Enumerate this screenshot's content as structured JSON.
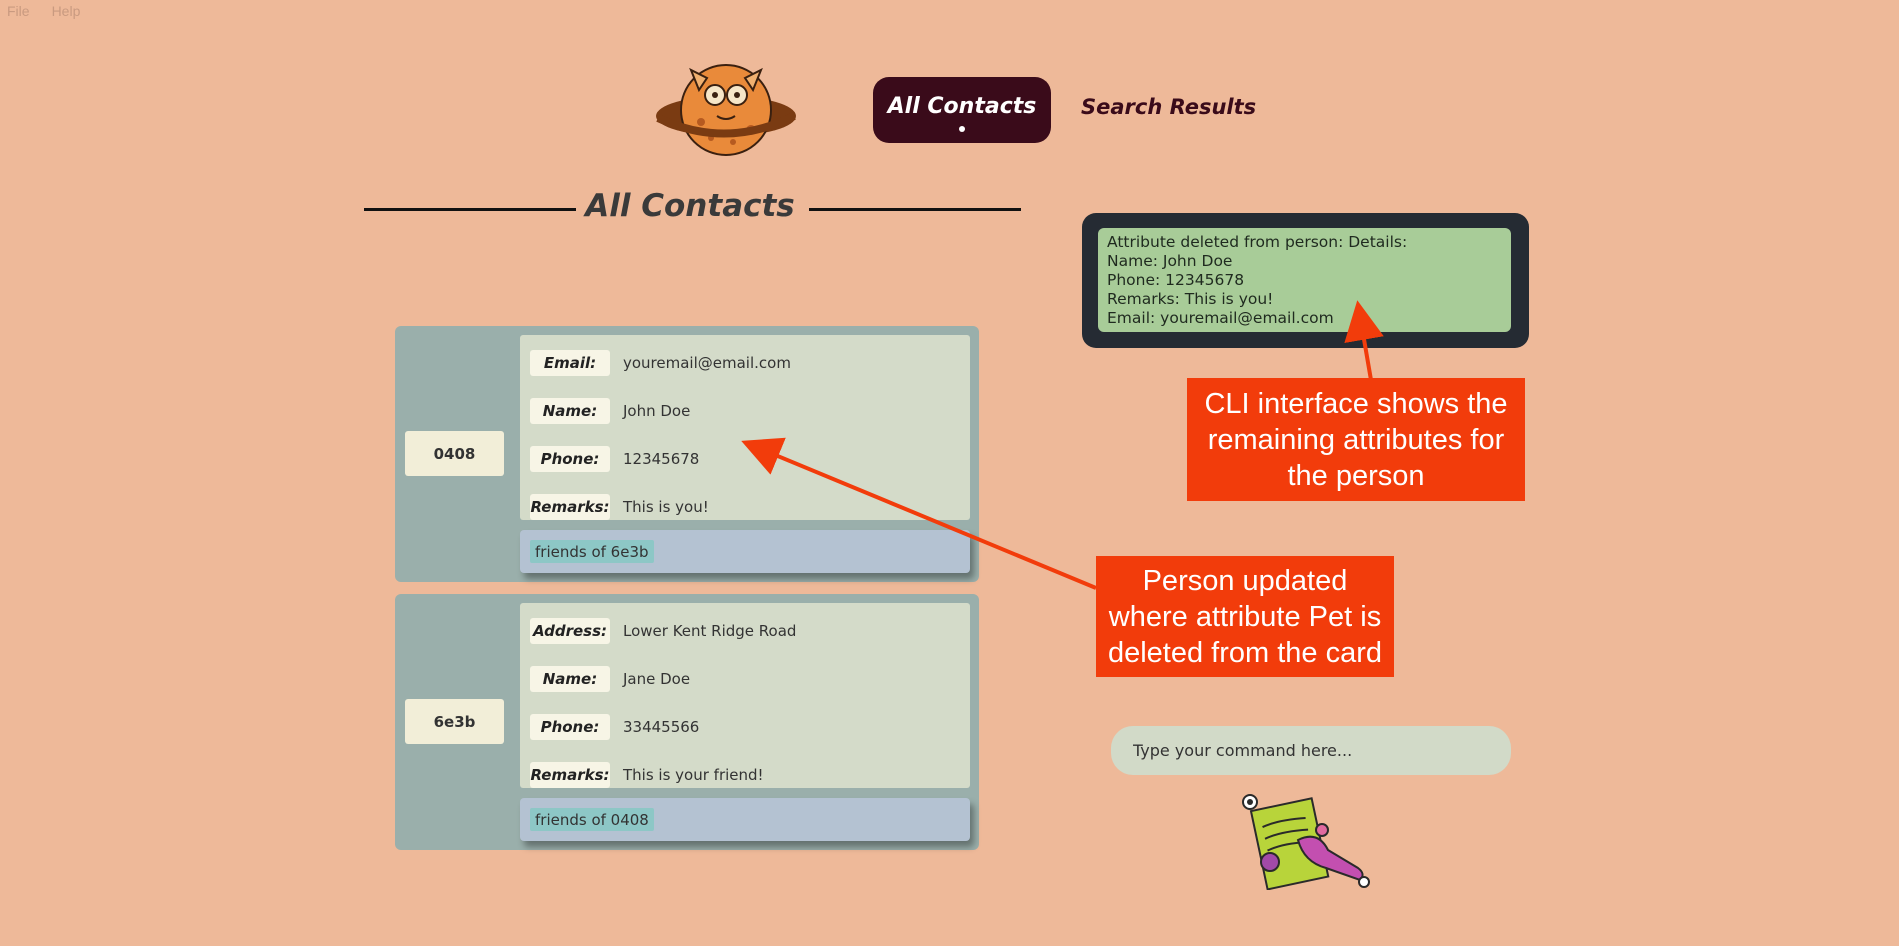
{
  "menu": {
    "file": "File",
    "help": "Help"
  },
  "nav": {
    "tabs": [
      {
        "label": "All Contacts",
        "active": true
      },
      {
        "label": "Search Results",
        "active": false
      }
    ]
  },
  "section_title": "All Contacts",
  "contacts": [
    {
      "id": "0408",
      "fields": [
        {
          "label": "Email:",
          "value": "youremail@email.com"
        },
        {
          "label": "Name:",
          "value": "John Doe"
        },
        {
          "label": "Phone:",
          "value": "12345678"
        },
        {
          "label": "Remarks:",
          "value": "This is you!"
        }
      ],
      "tag": "friends of 6e3b"
    },
    {
      "id": "6e3b",
      "fields": [
        {
          "label": "Address:",
          "value": "Lower Kent Ridge Road"
        },
        {
          "label": "Name:",
          "value": "Jane Doe"
        },
        {
          "label": "Phone:",
          "value": "33445566"
        },
        {
          "label": "Remarks:",
          "value": "This is your friend!"
        }
      ],
      "tag": "friends of 0408"
    }
  ],
  "cli_result": {
    "lines": [
      "Attribute deleted from person: Details:",
      "Name: John Doe",
      "Phone: 12345678",
      "Remarks: This is you!",
      "Email: youremail@email.com"
    ]
  },
  "command_input": {
    "placeholder": "Type your command here...",
    "value": ""
  },
  "annotations": {
    "cli": {
      "lines": [
        "CLI interface shows the",
        "remaining attributes for",
        "the person"
      ]
    },
    "person": {
      "lines": [
        "Person updated",
        "where attribute Pet is",
        "deleted from the card"
      ]
    }
  },
  "icons": {
    "logo": "planet-monster-logo-icon",
    "mascot": "document-monster-mascot-icon"
  },
  "colors": {
    "background": "#EEB999",
    "active_tab": "#3a0b1a",
    "card": "#9aafab",
    "fields_panel": "#d4dbc9",
    "tags_panel": "#b4c2d2",
    "tag": "#8dc7c6",
    "cli_frame": "#252b33",
    "cli_text_bg": "#a8cc98",
    "callout": "#f23c0b"
  }
}
